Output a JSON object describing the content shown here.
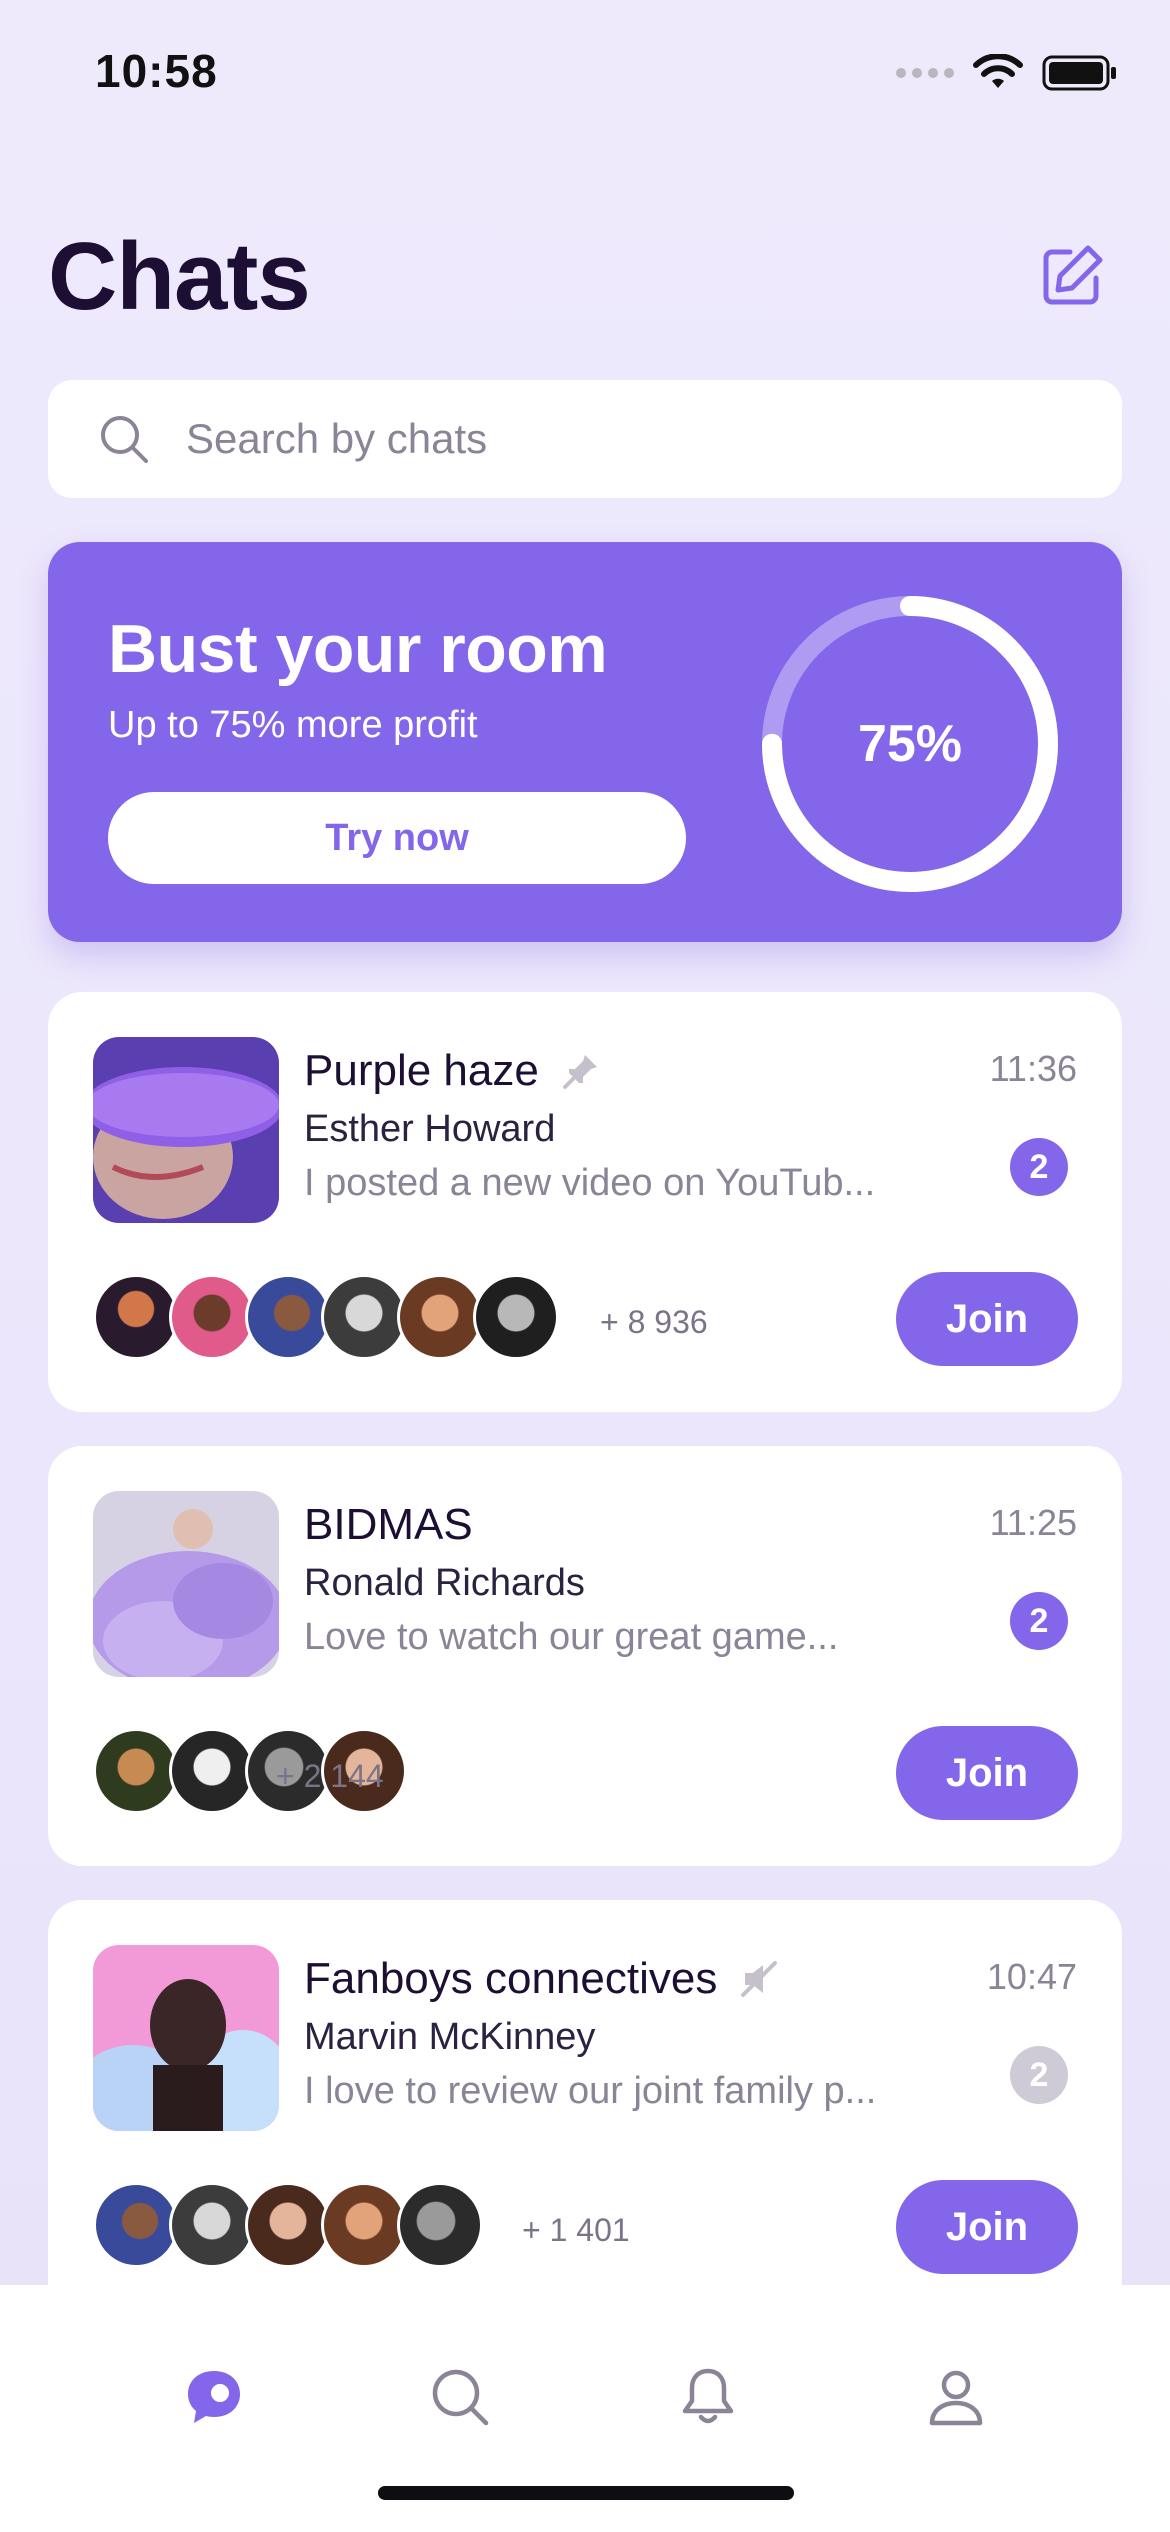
{
  "status_bar": {
    "time": "10:58"
  },
  "header": {
    "title": "Chats"
  },
  "search": {
    "placeholder": "Search by chats"
  },
  "promo": {
    "title": "Bust your room",
    "subtitle": "Up to 75% more profit",
    "button_label": "Try now",
    "progress_label": "75%",
    "progress_value": 0.75
  },
  "chats": [
    {
      "name": "Purple haze",
      "author": "Esther Howard",
      "message": "I posted a new video on YouTub...",
      "time": "11:36",
      "unread": "2",
      "status_icon": "pin-icon",
      "members_more": "+ 8 936",
      "join_label": "Join"
    },
    {
      "name": "BIDMAS",
      "author": "Ronald Richards",
      "message": "Love to watch our great game...",
      "time": "11:25",
      "unread": "2",
      "members_more": "+ 2 144",
      "join_label": "Join"
    },
    {
      "name": "Fanboys connectives",
      "author": "Marvin McKinney",
      "message": "I love to review our joint family p...",
      "time": "10:47",
      "unread": "2",
      "status_icon": "mute-icon",
      "members_more": "+ 1 401",
      "join_label": "Join"
    }
  ],
  "tab_bar": {
    "items": [
      "chat-bubble-icon",
      "search-icon",
      "bell-icon",
      "profile-icon"
    ],
    "active": "chat-bubble-icon"
  },
  "colors": {
    "accent": "#8466ea",
    "title": "#1d0f33",
    "muted": "#8a8496"
  }
}
